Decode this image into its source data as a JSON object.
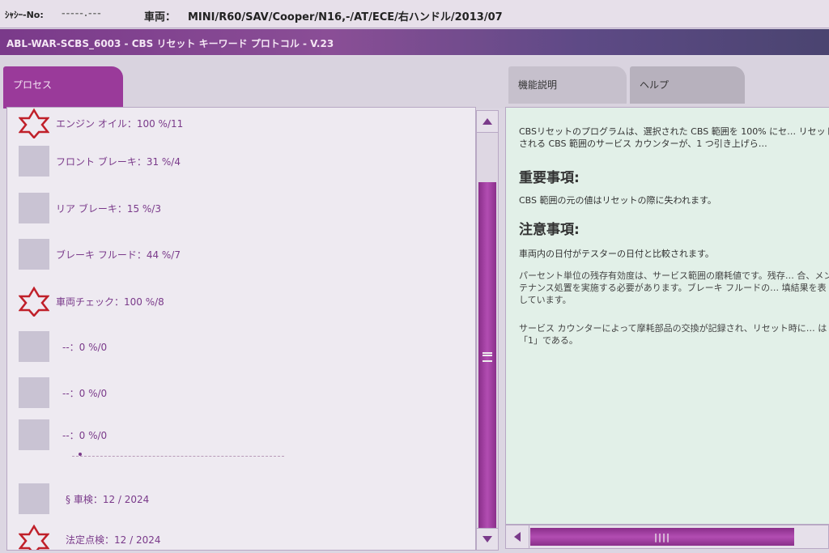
{
  "header": {
    "vin_label": "ｼｬｼｰ-No:",
    "vin_value": "-----.---",
    "vehicle_label": "車両：",
    "vehicle_value": "MINI/R60/SAV/Cooper/N16,-/AT/ECE/右ハンドル/2013/07"
  },
  "title": "ABL-WAR-SCBS_6003 - CBS リセット キーワード プロトコル - V.23",
  "tabs": {
    "process": "プロセス",
    "function": "機能説明",
    "help": "ヘルプ"
  },
  "items": [
    {
      "label": "エンジン オイル：100 %/11",
      "icon": "star-icon"
    },
    {
      "label": "フロント ブレーキ：31 %/4",
      "icon": "box"
    },
    {
      "label": "リア ブレーキ：15 %/3",
      "icon": "box"
    },
    {
      "label": "ブレーキ フルード：44 %/7",
      "icon": "box"
    },
    {
      "label": "車両チェック：100 %/8",
      "icon": "star-icon"
    },
    {
      "label": "--：0 %/0",
      "icon": "box"
    },
    {
      "label": "--：0 %/0",
      "icon": "box"
    },
    {
      "label": "--：0 %/0",
      "icon": "box"
    },
    {
      "label": "§ 車検：12 / 2024",
      "icon": "box"
    },
    {
      "label": "法定点検：12 / 2024",
      "icon": "star-icon"
    }
  ],
  "help": {
    "intro": "CBSリセットのプログラムは、選択された CBS 範囲を 100% にセ… リセットされる CBS 範囲のサービス カウンターが、1 つ引き上げら…",
    "important_heading": "重要事項:",
    "important_text": "CBS 範囲の元の値はリセットの際に失われます。",
    "caution_heading": "注意事項:",
    "caution_text": "車両内の日付がテスターの日付と比較されます。",
    "percent_text": "パーセント単位の残存有効度は、サービス範囲の磨耗値です。残存… 合、メンテナンス処置を実施する必要があります。ブレーキ フルードの… 填結果を表しています。",
    "counter_text": "サービス カウンターによって摩耗部品の交換が記録され、リセット時に… は「1」である。"
  },
  "colors": {
    "accent": "#9a3a9a",
    "star": "#c0202a"
  }
}
